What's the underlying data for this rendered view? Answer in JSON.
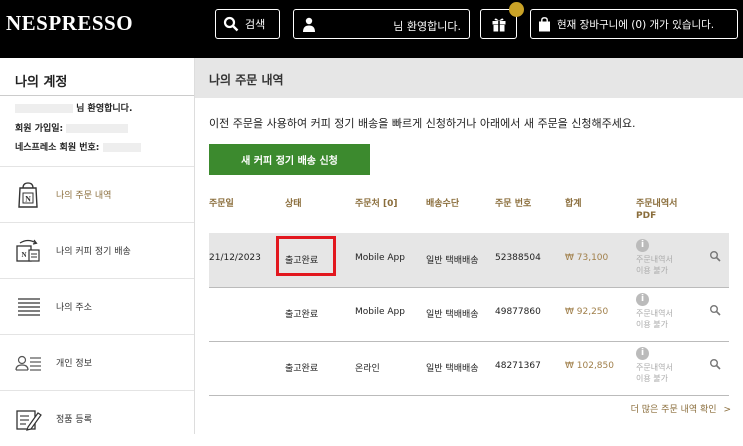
{
  "brand": {
    "logo": "NESPRESSO"
  },
  "topbar": {
    "search_label": "검색",
    "user_greeting": "님 환영합니다.",
    "cart_text": "현재 장바구니에 (0) 개가 있습니다.",
    "accent": "#c9a227"
  },
  "sidebar": {
    "title": "나의 계정",
    "greeting": "님 환영합니다.",
    "member_since_label": "회원 가입일:",
    "member_no_label": "네스프레소 회원 번호:",
    "items": [
      {
        "label": "나의 주문 내역",
        "icon": "coffee-bag-icon"
      },
      {
        "label": "나의 커피 정기 배송",
        "icon": "subscription-icon"
      },
      {
        "label": "나의 주소",
        "icon": "address-list-icon"
      },
      {
        "label": "개인 정보",
        "icon": "personal-info-icon"
      },
      {
        "label": "정품 등록",
        "icon": "product-register-icon"
      }
    ]
  },
  "main": {
    "title": "나의 주문 내역",
    "intro": "이전 주문을 사용하여 커피 정기 배송을 빠르게 신청하거나 아래에서 새 주문을 신청해주세요.",
    "cta_label": "새 커피 정기 배송 신청",
    "columns": [
      "주문일",
      "상태",
      "주문처 [0]",
      "배송수단",
      "주문 번호",
      "합계",
      "주문내역서",
      "PDF"
    ],
    "orders": [
      {
        "date": "21/12/2023",
        "status": "출고완료",
        "channel": "Mobile App",
        "shipping": "일반 택배배송",
        "order_no": "52388504",
        "total": "₩ 73,100",
        "pdf_1": "주문내역서",
        "pdf_2": "이용 불가"
      },
      {
        "date": "",
        "status": "출고완료",
        "channel": "Mobile App",
        "shipping": "일반 택배배송",
        "order_no": "49877860",
        "total": "₩ 92,250",
        "pdf_1": "주문내역서",
        "pdf_2": "이용 불가"
      },
      {
        "date": "",
        "status": "출고완료",
        "channel": "온라인",
        "shipping": "일반 택배배송",
        "order_no": "48271367",
        "total": "₩ 102,850",
        "pdf_1": "주문내역서",
        "pdf_2": "이용 불가"
      }
    ],
    "more_link": "더 많은 주문 내역 확인",
    "more_chevron": ">",
    "highlight_color": "#e2171e",
    "button_color": "#3c8a2e"
  }
}
